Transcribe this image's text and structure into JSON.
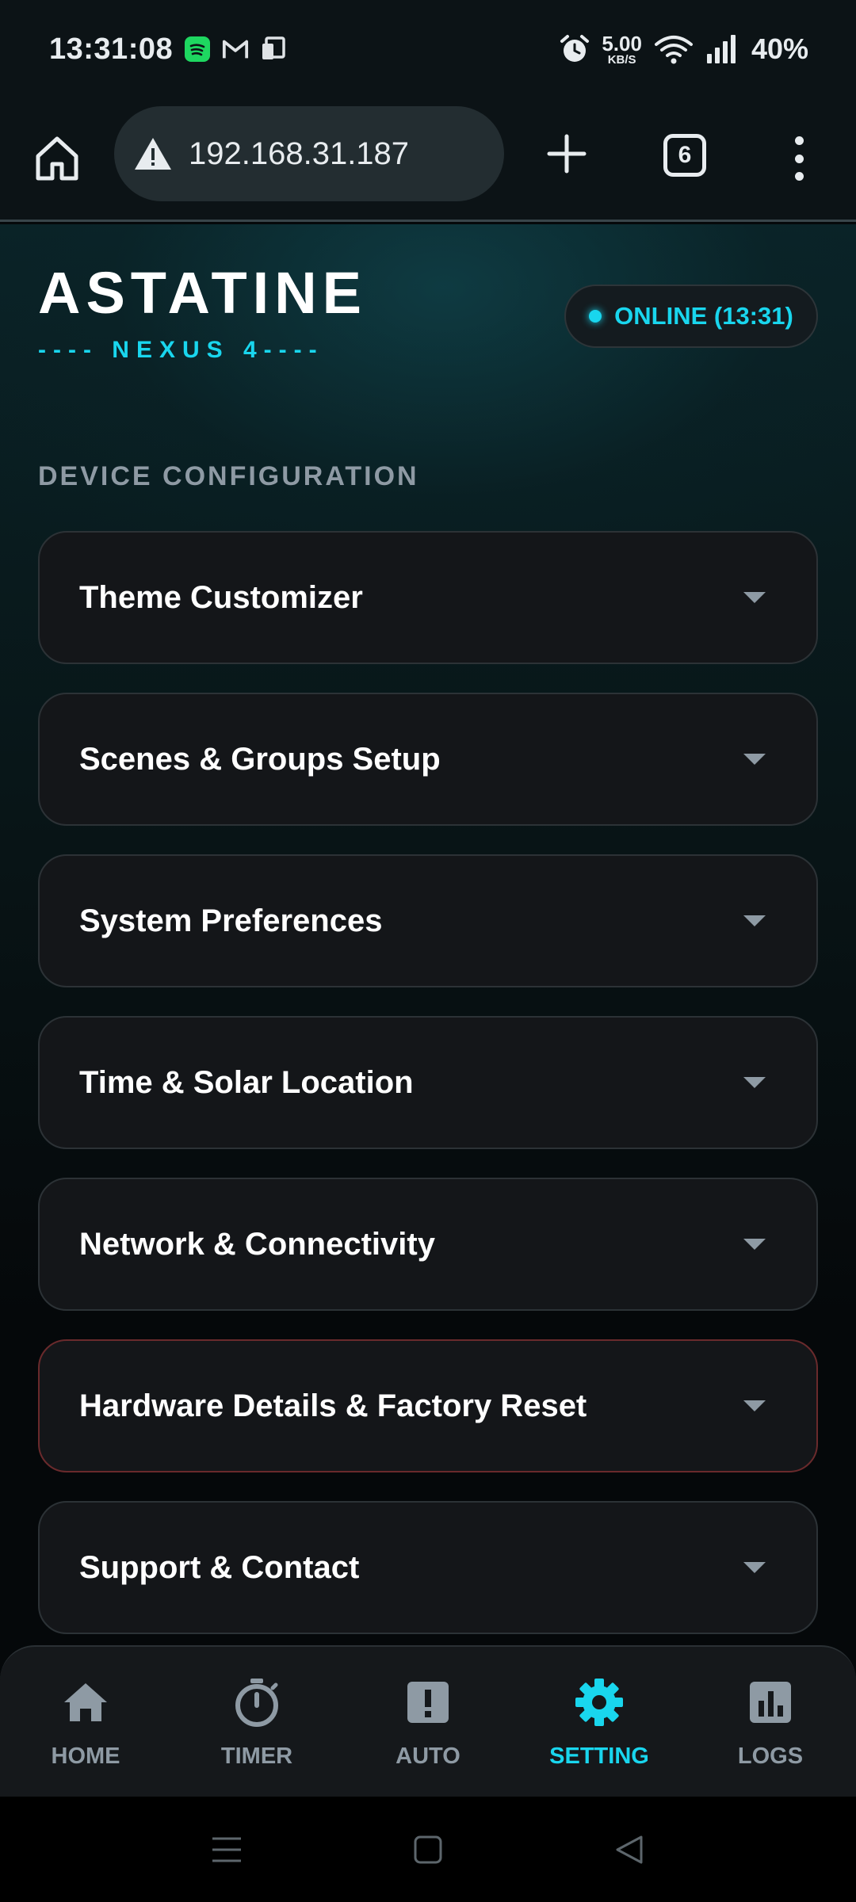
{
  "status_bar": {
    "time": "13:31:08",
    "speed_value": "5.00",
    "speed_unit": "KB/S",
    "battery": "40%",
    "icons": [
      "spotify-icon",
      "gmail-icon",
      "device-icon",
      "alarm-icon",
      "wifi-icon",
      "signal-icon"
    ]
  },
  "browser": {
    "url": "192.168.31.187",
    "tab_count": "6",
    "icons": [
      "home-icon",
      "warning-icon",
      "plus-icon",
      "more-vertical-icon"
    ]
  },
  "header": {
    "title": "ASTATINE",
    "subtitle": "---- NEXUS 4----",
    "status": "ONLINE (13:31)"
  },
  "section": {
    "title": "DEVICE CONFIGURATION"
  },
  "accordions": [
    {
      "label": "Theme Customizer"
    },
    {
      "label": "Scenes & Groups Setup"
    },
    {
      "label": "System Preferences"
    },
    {
      "label": "Time & Solar Location"
    },
    {
      "label": "Network & Connectivity"
    },
    {
      "label": "Hardware Details & Factory Reset"
    },
    {
      "label": "Support & Contact"
    }
  ],
  "nav": [
    {
      "label": "HOME",
      "icon": "home-icon"
    },
    {
      "label": "TIMER",
      "icon": "stopwatch-icon"
    },
    {
      "label": "AUTO",
      "icon": "alert-icon"
    },
    {
      "label": "SETTING",
      "icon": "gear-icon",
      "active": true
    },
    {
      "label": "LOGS",
      "icon": "bar-chart-icon"
    }
  ],
  "colors": {
    "accent": "#19d6ee",
    "muted": "#8e9aa4",
    "card": "#141619",
    "danger_border": "#6a2a2c"
  }
}
